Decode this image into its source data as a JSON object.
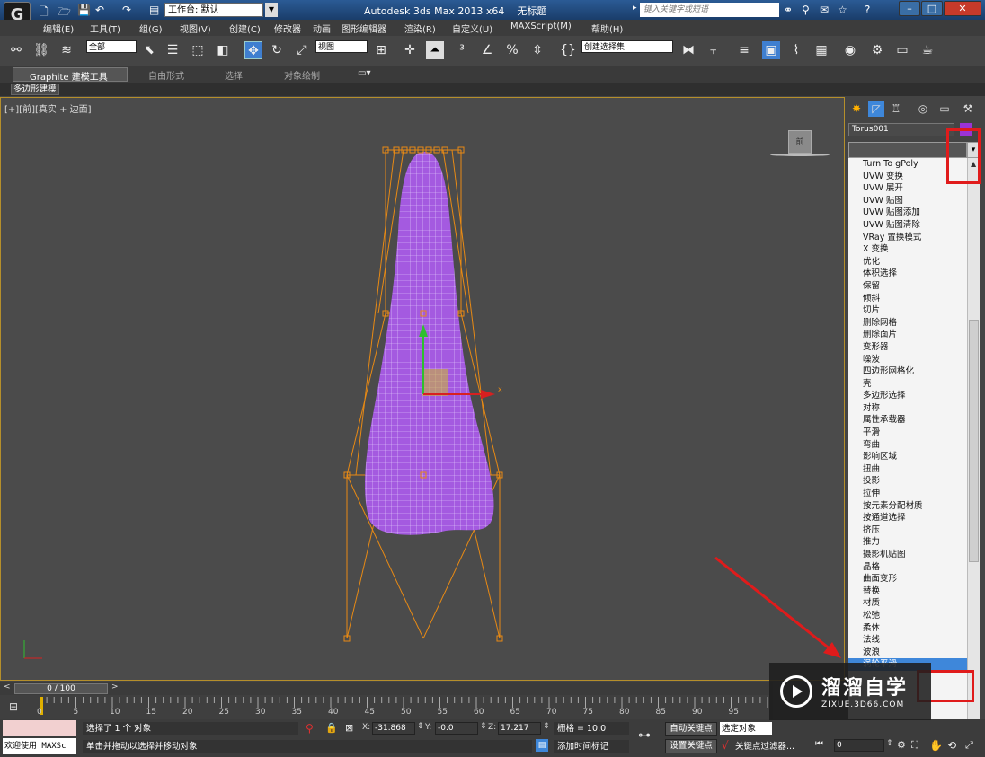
{
  "app": {
    "title": "Autodesk 3ds Max  2013 x64",
    "doc_title": "无标题",
    "workspace": "工作台: 默认",
    "search_placeholder": "键入关键字或短语"
  },
  "menu": [
    "编辑(E)",
    "工具(T)",
    "组(G)",
    "视图(V)",
    "创建(C)",
    "修改器",
    "动画",
    "图形编辑器",
    "渲染(R)",
    "自定义(U)",
    "MAXScript(M)",
    "帮助(H)"
  ],
  "toolbar": {
    "filter": "全部",
    "ref_coord": "视图",
    "selection_set": "创建选择集"
  },
  "ribbon": {
    "tabs": [
      "Graphite 建模工具",
      "自由形式",
      "选择",
      "对象绘制"
    ],
    "sub_label": "多边形建模"
  },
  "viewport": {
    "label": "[+][前][真实 + 边面]",
    "viewcube_label": "前",
    "axis_x": "x"
  },
  "command_panel": {
    "object_name": "Torus001",
    "object_color": "#9b33d6",
    "modifier_list": [
      "Turn To gPoly",
      "UVW 变换",
      "UVW 展开",
      "UVW 贴图",
      "UVW 贴图添加",
      "UVW 贴图清除",
      "VRay 置换模式",
      "X 变换",
      "优化",
      "体积选择",
      "保留",
      "倾斜",
      "切片",
      "删除网格",
      "删除面片",
      "变形器",
      "噪波",
      "四边形网格化",
      "壳",
      "多边形选择",
      "对称",
      "属性承载器",
      "平滑",
      "弯曲",
      "影响区域",
      "扭曲",
      "投影",
      "拉伸",
      "按元素分配材质",
      "按通道选择",
      "挤压",
      "推力",
      "摄影机贴图",
      "晶格",
      "曲面变形",
      "替换",
      "材质",
      "松弛",
      "柔体",
      "法线",
      "波浪",
      "涡轮平滑"
    ],
    "selected_index": 41
  },
  "timeline": {
    "frame": "0 / 100",
    "ticks": [
      "0",
      "5",
      "10",
      "15",
      "20",
      "25",
      "30",
      "35",
      "40",
      "45",
      "50",
      "55",
      "60",
      "65",
      "70",
      "75",
      "80",
      "85",
      "90",
      "95"
    ]
  },
  "status": {
    "maxscript_label": "欢迎使用 MAXSc",
    "selected": "选择了 1 个 对象",
    "prompt": "单击并拖动以选择并移动对象",
    "x": "-31.868",
    "y": "-0.0",
    "z": "17.217",
    "grid": "栅格 = 10.0",
    "auto_key": "自动关键点",
    "set_key": "设置关键点",
    "selection_dropdown": "选定对象",
    "key_filter": "关键点过滤器...",
    "add_time_tag": "添加时间标记",
    "frame_input": "0"
  },
  "watermark": {
    "brand": "溜溜自学",
    "url": "ZIXUE.3D66.COM"
  },
  "colors": {
    "mesh": "#a45ae0",
    "gizmo": "#e88a14",
    "annotation": "#e01b1b",
    "selected_row": "#3e87da"
  }
}
